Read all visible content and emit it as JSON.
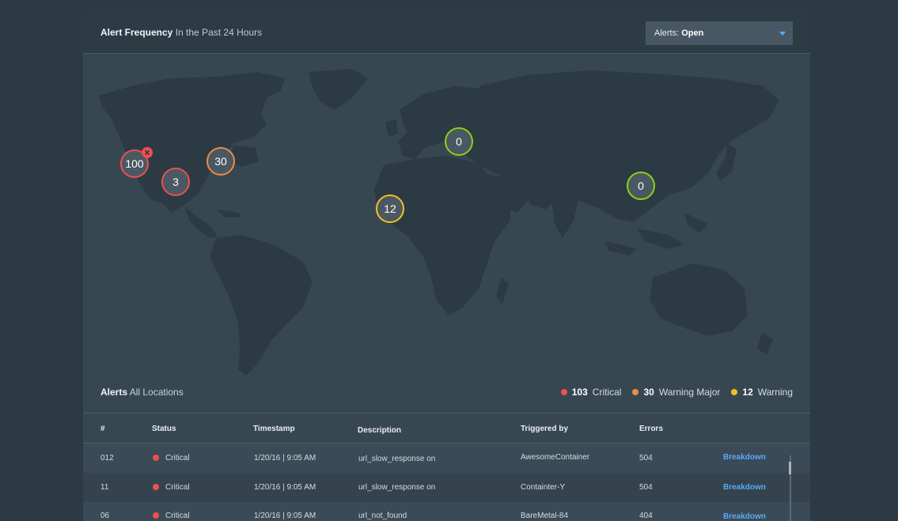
{
  "header": {
    "title": "Alert Frequency",
    "subtitle": "In the Past 24 Hours",
    "filter_label": "Alerts:",
    "filter_value": "Open"
  },
  "map": {
    "markers": [
      {
        "value": "100",
        "status": "critical",
        "color": "#ef4f4f",
        "removable": true
      },
      {
        "value": "3",
        "status": "critical",
        "color": "#ef4f4f"
      },
      {
        "value": "30",
        "status": "warning-major",
        "color": "#f08b3f"
      },
      {
        "value": "12",
        "status": "warning",
        "color": "#f2c01e"
      },
      {
        "value": "0",
        "status": "ok",
        "color": "#8cd211"
      },
      {
        "value": "0",
        "status": "ok",
        "color": "#8cd211"
      }
    ]
  },
  "alerts": {
    "title": "Alerts",
    "subtitle": "All Locations",
    "legend": [
      {
        "count": "103",
        "label": "Critical",
        "color": "#ef4f4f"
      },
      {
        "count": "30",
        "label": "Warning Major",
        "color": "#f08b3f"
      },
      {
        "count": "12",
        "label": "Warning",
        "color": "#f2c01e"
      }
    ]
  },
  "table": {
    "columns": [
      "#",
      "Status",
      "Timestamp",
      "Description",
      "Triggered by",
      "Errors"
    ],
    "rows": [
      {
        "id": "012",
        "status": "Critical",
        "timestamp": "1/20/16 | 9:05 AM",
        "description": "url_slow_response on",
        "triggered_by": "AwesomeContainer",
        "errors": "504",
        "action": "Breakdown"
      },
      {
        "id": "11",
        "status": "Critical",
        "timestamp": "1/20/16 | 9:05 AM",
        "description": "url_slow_response on",
        "triggered_by": "Containter-Y",
        "errors": "504",
        "action": "Breakdown"
      },
      {
        "id": "06",
        "status": "Critical",
        "timestamp": "1/20/16 | 9:05 AM",
        "description": "url_not_found",
        "triggered_by": "BareMetal-84",
        "errors": "404",
        "action": "Breakdown"
      }
    ]
  }
}
